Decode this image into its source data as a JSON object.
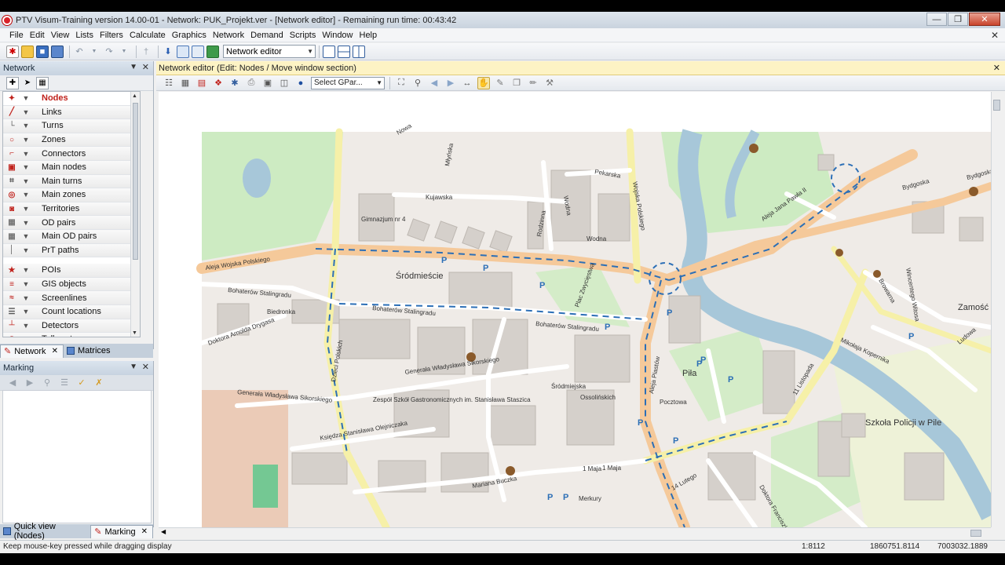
{
  "window": {
    "title": "PTV Visum-Training version 14.00-01 - Network: PUK_Projekt.ver - [Network editor] - Remaining run time: 00:43:42"
  },
  "menu": [
    "File",
    "Edit",
    "View",
    "Lists",
    "Filters",
    "Calculate",
    "Graphics",
    "Network",
    "Demand",
    "Scripts",
    "Window",
    "Help"
  ],
  "toolbar": {
    "mode_select": "Network editor"
  },
  "network_panel": {
    "title": "Network",
    "items": [
      {
        "label": "Nodes",
        "icon": "node-icon"
      },
      {
        "label": "Links",
        "icon": "link-icon"
      },
      {
        "label": "Turns",
        "icon": "turn-icon"
      },
      {
        "label": "Zones",
        "icon": "zone-icon"
      },
      {
        "label": "Connectors",
        "icon": "connector-icon"
      },
      {
        "label": "Main nodes",
        "icon": "main-node-icon"
      },
      {
        "label": "Main turns",
        "icon": "main-turn-icon"
      },
      {
        "label": "Main zones",
        "icon": "main-zone-icon"
      },
      {
        "label": "Territories",
        "icon": "territory-icon"
      },
      {
        "label": "OD pairs",
        "icon": "od-pair-icon"
      },
      {
        "label": "Main OD pairs",
        "icon": "main-od-pair-icon"
      },
      {
        "label": "PrT paths",
        "icon": "prt-path-icon"
      },
      {
        "label": "POIs",
        "icon": "poi-icon"
      },
      {
        "label": "GIS objects",
        "icon": "gis-icon"
      },
      {
        "label": "Screenlines",
        "icon": "screenline-icon"
      },
      {
        "label": "Count locations",
        "icon": "count-location-icon"
      },
      {
        "label": "Detectors",
        "icon": "detector-icon"
      },
      {
        "label": "Toll systems",
        "icon": "toll-icon"
      }
    ],
    "tabs": [
      "Network",
      "Matrices"
    ]
  },
  "marking_panel": {
    "title": "Marking",
    "tabs": [
      "Quick view (Nodes)",
      "Marking"
    ]
  },
  "editor": {
    "header": "Network editor (Edit: Nodes / Move window section)",
    "gpar_select": "Select GPar..."
  },
  "map": {
    "labels": [
      "Aleja Wojska Polskiego",
      "Śródmieście",
      "Kujawska",
      "Gimnazjum nr 4",
      "Bohaterów Stalingradu",
      "Bohaterów Stalingradu",
      "Bohaterów Stalingradu",
      "Wodna",
      "Pekarska",
      "Aleja Jana Pawła II",
      "Bydgoska",
      "Bydgoska",
      "Zamość",
      "Piła",
      "Szkoła Policji w Pile",
      "Generała Władysława Sikorskiego",
      "Generała Władysława Sikorskiego",
      "Zespół Szkół Gastronomicznych im. Stanisława Staszica",
      "Księdza Stanisława Olejniczaka",
      "Mariana Buczka",
      "1 Maja",
      "1 Maja",
      "Aleja Piastów",
      "Śródmiejska",
      "Pocztowa",
      "11 Listopada",
      "14 Lutego",
      "Ludowa",
      "Doktora Arnolda Drygasa",
      "Dzieci Polskich",
      "Rodzinna",
      "Plac Zwycięstwa",
      "Ossolińskich",
      "Wincentego Witosa",
      "Browarna",
      "Mikołaja Kopernika",
      "Biedronka",
      "Merkury",
      "Wojska Polskiego",
      "Wodna",
      "Nowa",
      "Młyńska",
      "Doktora Franciszka Witaszka"
    ],
    "accent_road": "#f5c99a",
    "water": "#a7c7d9",
    "park": "#cdebc2"
  },
  "status": {
    "message": "Keep mouse-key pressed while dragging display",
    "scale": "1:8112",
    "x": "1860751.8114",
    "y": "7003032.1889"
  }
}
